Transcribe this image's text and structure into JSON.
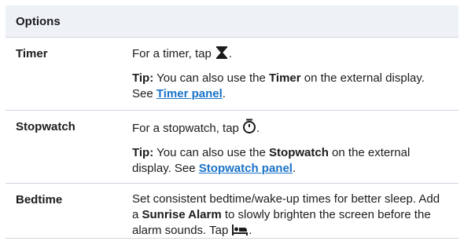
{
  "header": {
    "title": "Options"
  },
  "rows": [
    {
      "name": "Timer",
      "line1": "For a timer, tap",
      "line1_end": ".",
      "tip_label": "Tip:",
      "tip_pre": "You can also use the",
      "tip_bold": "Timer",
      "tip_mid": "on the external display. See",
      "tip_link": "Timer panel",
      "tip_end": ".",
      "icon": "hourglass-icon"
    },
    {
      "name": "Stopwatch",
      "line1": "For a stopwatch, tap",
      "line1_end": ".",
      "tip_label": "Tip:",
      "tip_pre": "You can also use the",
      "tip_bold": "Stopwatch",
      "tip_mid": "on the external display. See",
      "tip_link": "Stopwatch panel",
      "tip_end": ".",
      "icon": "stopwatch-icon"
    },
    {
      "name": "Bedtime",
      "text_pre": "Set consistent bedtime/wake-up times for better sleep. Add a",
      "text_bold": "Sunrise Alarm",
      "text_post": "to slowly brighten the screen before the alarm sounds. Tap",
      "text_end": ".",
      "icon": "bed-icon"
    }
  ],
  "colors": {
    "header_bg": "#eef2f7",
    "link": "#1a73c9",
    "border": "#cfd6df"
  }
}
